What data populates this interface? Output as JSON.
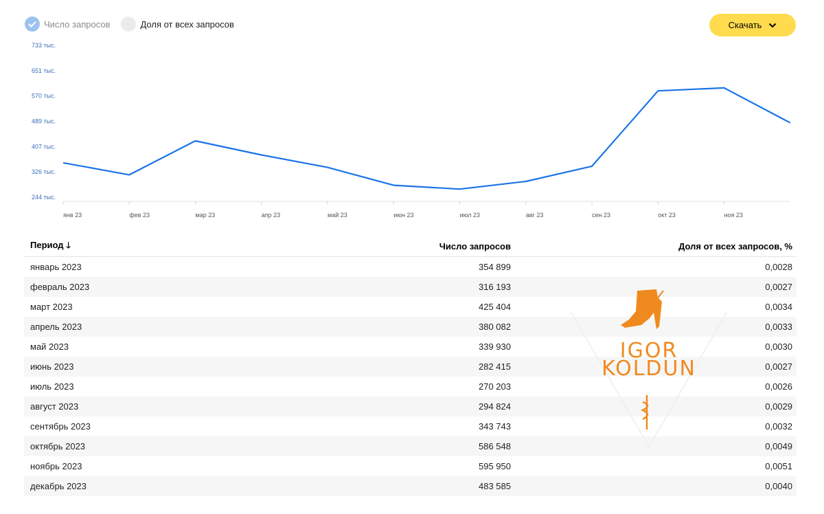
{
  "legend": {
    "items": [
      {
        "label": "Число запросов",
        "active": true
      },
      {
        "label": "Доля от всех запросов",
        "active": false
      }
    ]
  },
  "download": {
    "label": "Скачать"
  },
  "colors": {
    "line": "#1a73e8",
    "accent": "#ffdb4d",
    "tick": "#3b6fb8"
  },
  "chart_data": {
    "type": "line",
    "categories": [
      "янв 23",
      "фев 23",
      "мар 23",
      "апр 23",
      "май 23",
      "июн 23",
      "июл 23",
      "авг 23",
      "сен 23",
      "окт 23",
      "ноя 23",
      "дек 23"
    ],
    "series": [
      {
        "values": [
          354899,
          316193,
          425404,
          380082,
          339930,
          282415,
          270203,
          294824,
          343743,
          586548,
          595950,
          483585
        ]
      }
    ],
    "yticks": [
      "244 тыс.",
      "326 тыс.",
      "407 тыс.",
      "489 тыс.",
      "570 тыс.",
      "651 тыс.",
      "733 тыс."
    ],
    "xtick_labels": [
      "янв 23",
      "фев 23",
      "мар 23",
      "апр 23",
      "май 23",
      "июн 23",
      "июл 23",
      "авг 23",
      "сен 23",
      "окт 23",
      "ноя 23"
    ],
    "ylim": [
      244000,
      733000
    ],
    "grid": false
  },
  "table": {
    "headers": [
      "Период",
      "Число запросов",
      "Доля от всех запросов, %"
    ],
    "sort_icon": "arrow-down-icon",
    "rows": [
      [
        "январь 2023",
        "354 899",
        "0,0028"
      ],
      [
        "февраль 2023",
        "316 193",
        "0,0027"
      ],
      [
        "март 2023",
        "425 404",
        "0,0034"
      ],
      [
        "апрель 2023",
        "380 082",
        "0,0033"
      ],
      [
        "май 2023",
        "339 930",
        "0,0030"
      ],
      [
        "июнь 2023",
        "282 415",
        "0,0027"
      ],
      [
        "июль 2023",
        "270 203",
        "0,0026"
      ],
      [
        "август 2023",
        "294 824",
        "0,0029"
      ],
      [
        "сентябрь 2023",
        "343 743",
        "0,0032"
      ],
      [
        "октябрь 2023",
        "586 548",
        "0,0049"
      ],
      [
        "ноябрь 2023",
        "595 950",
        "0,0051"
      ],
      [
        "декабрь 2023",
        "483 585",
        "0,0040"
      ]
    ]
  },
  "watermark": {
    "line1": "IGOR",
    "line2": "KOLDUN"
  }
}
